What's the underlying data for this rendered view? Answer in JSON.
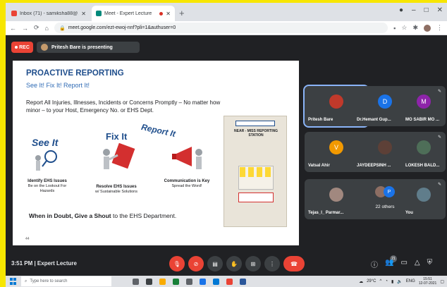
{
  "browser": {
    "tabs": [
      {
        "title": "Inbox (71) - samiksha88@... ",
        "favicon_color": "#ea4335",
        "active": false
      },
      {
        "title": "Meet - Expert Lecture",
        "favicon_color": "#00897b",
        "active": true
      }
    ],
    "new_tab_icon": "+",
    "url": "meet.google.com/ezt-ewoj-nnf?pli=1&authuser=0",
    "window_controls": [
      "–",
      "□",
      "✕"
    ]
  },
  "meet": {
    "rec_label": "REC",
    "presenting_text": "Pritesh Bare is presenting",
    "slide": {
      "title": "PROACTIVE REPORTING",
      "subtitle": "See It!  Fix It!  Report It!",
      "body": "Report All Injuries, Illnesses, Incidents or Concerns Promptly – No matter how minor – to your Host, Emergency No. or EHS Dept.",
      "word_see": "See It",
      "word_fix": "Fix It",
      "word_report": "Report It",
      "captions": [
        {
          "title": "Identify EHS Issues",
          "detail": "Be on the Lookout For Hazards"
        },
        {
          "title": "Resolve EHS Issues",
          "detail": "w/ Sustainable Solutions"
        },
        {
          "title": "Communication is Key",
          "detail": "Spread the Word!"
        }
      ],
      "board_title": "NEAR - MISS REPORTING STATION",
      "bottom_bold": "When in Doubt, Give a Shout",
      "bottom_rest": " to the EHS Department.",
      "page_number": "44"
    },
    "participants": [
      {
        "name": "Pritesh Bare",
        "initial": "",
        "color": "#c0392b",
        "active": true
      },
      {
        "name": "Dr.Hemant Gup...",
        "initial": "D",
        "color": "#1a73e8",
        "active": false
      },
      {
        "name": "MO SABIR MO ...",
        "initial": "M",
        "color": "#8e24aa",
        "active": false
      },
      {
        "name": "Vatsal Ahir",
        "initial": "V",
        "color": "#f29900",
        "active": false
      },
      {
        "name": "JAYDEEPSINH ...",
        "initial": "",
        "color": "#5d4037",
        "active": false
      },
      {
        "name": "LOKESH BALD...",
        "initial": "",
        "color": "#4e6e58",
        "active": false
      },
      {
        "name": "Tejas_I_ Parmar...",
        "initial": "",
        "color": "#a1887f",
        "active": false
      },
      {
        "name": "22 others",
        "initial": "P",
        "color": "#1a73e8",
        "active": false
      },
      {
        "name": "You",
        "initial": "",
        "color": "#607d8b",
        "active": false
      }
    ],
    "clock": "3:51 PM",
    "meeting_title": "Expert Lecture",
    "people_count": "21"
  },
  "taskbar": {
    "search_placeholder": "Type here to search",
    "temperature": "29°C",
    "lang": "ENG",
    "time": "15:51",
    "date": "12-07-2021"
  }
}
